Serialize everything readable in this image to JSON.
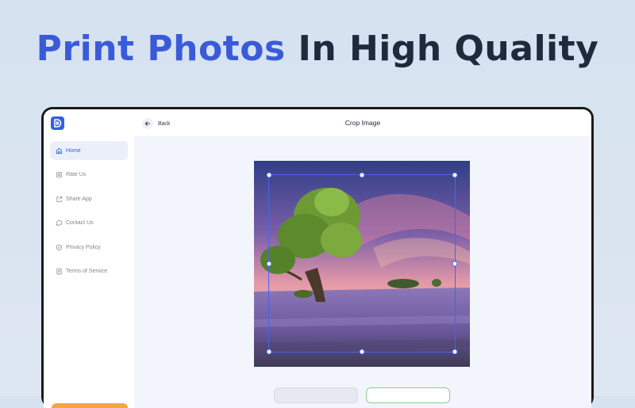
{
  "headline": {
    "accent": "Print Photos",
    "rest": "In High Quality"
  },
  "app": {
    "sidebar": {
      "items": [
        {
          "label": "Home",
          "icon": "home-icon",
          "active": true
        },
        {
          "label": "Rate Us",
          "icon": "rate-icon"
        },
        {
          "label": "Share App",
          "icon": "share-icon"
        },
        {
          "label": "Contact Us",
          "icon": "chat-icon"
        },
        {
          "label": "Privacy Policy",
          "icon": "shield-icon"
        },
        {
          "label": "Terms of Service",
          "icon": "document-icon"
        }
      ]
    },
    "topbar": {
      "back_label": "Back",
      "title": "Crop Image"
    }
  },
  "colors": {
    "accent": "#3a5bd9",
    "crop": "#4a63e8",
    "cta": "#f2a54a"
  }
}
